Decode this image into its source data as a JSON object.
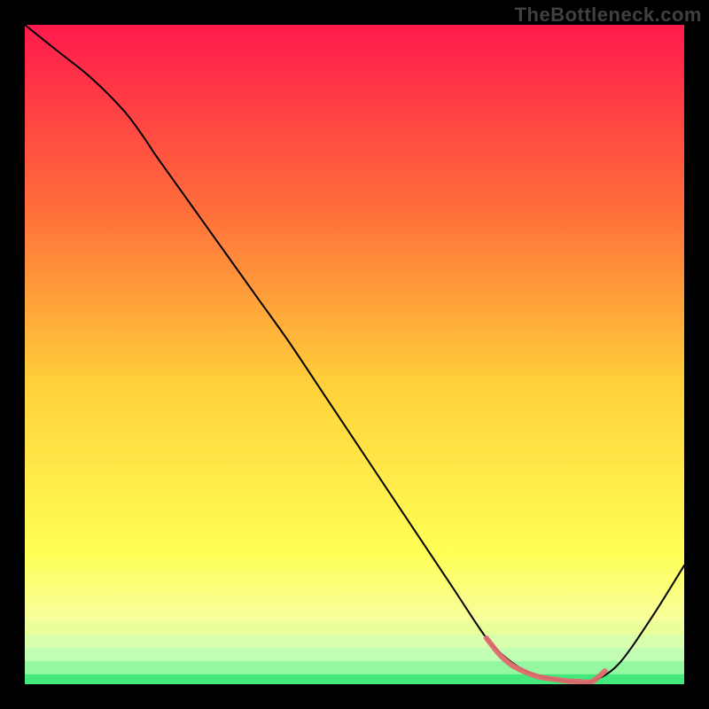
{
  "watermark": "TheBottleneck.com",
  "chart_data": {
    "type": "line",
    "title": "",
    "xlabel": "",
    "ylabel": "",
    "xlim": [
      0,
      100
    ],
    "ylim": [
      0,
      100
    ],
    "grid": false,
    "legend": null,
    "background_gradient": {
      "top": "#ff1a4d",
      "mid1": "#ff6e3a",
      "mid2": "#ffd23a",
      "mid3": "#ffff55",
      "mid4": "#f4ffb0",
      "bottom": "#00e36a"
    },
    "series": [
      {
        "name": "bottleneck-curve",
        "stroke": "#000000",
        "stroke_width": 2,
        "x": [
          0,
          5,
          10,
          15,
          18,
          20,
          25,
          30,
          35,
          40,
          45,
          50,
          55,
          60,
          65,
          70,
          73,
          76,
          80,
          83,
          86,
          90,
          95,
          100
        ],
        "values": [
          100,
          96,
          92,
          87,
          83,
          80,
          73,
          66,
          59,
          52,
          44.5,
          37,
          29.5,
          22,
          14.5,
          7,
          4,
          2,
          0.8,
          0.4,
          0.4,
          3,
          10,
          18
        ]
      },
      {
        "name": "optimal-region-marker",
        "stroke": "#e06a6f",
        "stroke_width": 6,
        "x": [
          70,
          72,
          74,
          76,
          78,
          80,
          82,
          84,
          86,
          88
        ],
        "values": [
          7,
          4.5,
          2.8,
          1.8,
          1.1,
          0.8,
          0.5,
          0.4,
          0.4,
          2.0
        ]
      }
    ]
  }
}
